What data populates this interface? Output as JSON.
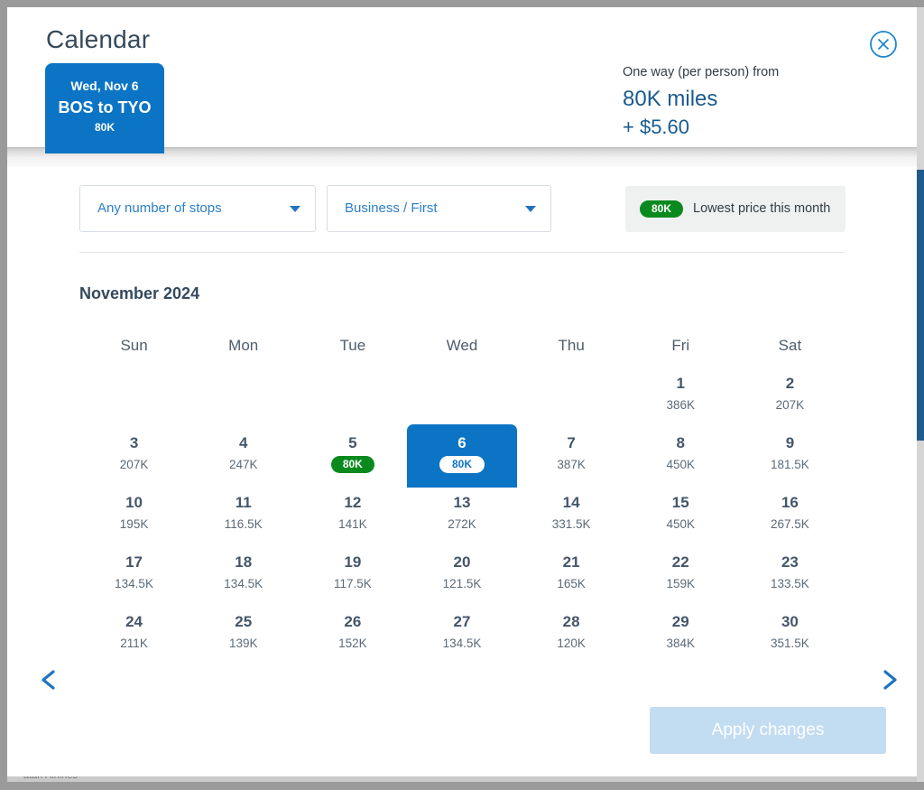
{
  "background": {
    "bottom_text": "atari Airlines"
  },
  "header": {
    "title": "Calendar",
    "route_card": {
      "date": "Wed, Nov 6",
      "route": "BOS to TYO",
      "miles": "80K"
    },
    "price": {
      "label": "One way (per person) from",
      "miles": "80K miles",
      "tax": "+ $5.60"
    },
    "close_icon": "close-circle-icon"
  },
  "filters": {
    "stops": {
      "value": "Any number of stops",
      "caret_icon": "chevron-down-icon"
    },
    "cabin": {
      "value": "Business / First",
      "caret_icon": "chevron-down-icon"
    },
    "legend": {
      "badge": "80K",
      "text": "Lowest price this month"
    }
  },
  "calendar": {
    "month_label": "November 2024",
    "day_headers": [
      "Sun",
      "Mon",
      "Tue",
      "Wed",
      "Thu",
      "Fri",
      "Sat"
    ],
    "prev_icon": "chevron-left-icon",
    "next_icon": "chevron-right-icon",
    "weeks": [
      [
        {
          "day": "",
          "price": ""
        },
        {
          "day": "",
          "price": ""
        },
        {
          "day": "",
          "price": ""
        },
        {
          "day": "",
          "price": ""
        },
        {
          "day": "",
          "price": ""
        },
        {
          "day": "1",
          "price": "386K"
        },
        {
          "day": "2",
          "price": "207K"
        }
      ],
      [
        {
          "day": "3",
          "price": "207K"
        },
        {
          "day": "4",
          "price": "247K"
        },
        {
          "day": "5",
          "price": "80K",
          "lowest": true
        },
        {
          "day": "6",
          "price": "80K",
          "selected": true
        },
        {
          "day": "7",
          "price": "387K"
        },
        {
          "day": "8",
          "price": "450K"
        },
        {
          "day": "9",
          "price": "181.5K"
        }
      ],
      [
        {
          "day": "10",
          "price": "195K"
        },
        {
          "day": "11",
          "price": "116.5K"
        },
        {
          "day": "12",
          "price": "141K"
        },
        {
          "day": "13",
          "price": "272K"
        },
        {
          "day": "14",
          "price": "331.5K"
        },
        {
          "day": "15",
          "price": "450K"
        },
        {
          "day": "16",
          "price": "267.5K"
        }
      ],
      [
        {
          "day": "17",
          "price": "134.5K"
        },
        {
          "day": "18",
          "price": "134.5K"
        },
        {
          "day": "19",
          "price": "117.5K"
        },
        {
          "day": "20",
          "price": "121.5K"
        },
        {
          "day": "21",
          "price": "165K"
        },
        {
          "day": "22",
          "price": "159K"
        },
        {
          "day": "23",
          "price": "133.5K"
        }
      ],
      [
        {
          "day": "24",
          "price": "211K"
        },
        {
          "day": "25",
          "price": "139K"
        },
        {
          "day": "26",
          "price": "152K"
        },
        {
          "day": "27",
          "price": "134.5K"
        },
        {
          "day": "28",
          "price": "120K"
        },
        {
          "day": "29",
          "price": "384K"
        },
        {
          "day": "30",
          "price": "351.5K"
        }
      ]
    ]
  },
  "footer": {
    "apply_label": "Apply changes"
  },
  "colors": {
    "brand_blue": "#0c74c4",
    "link_blue": "#2b7fc9",
    "deep_blue": "#1a5b8f",
    "lowest_green": "#0a8a1e",
    "apply_disabled": "#c2dcf2",
    "text_dark": "#44566a"
  }
}
